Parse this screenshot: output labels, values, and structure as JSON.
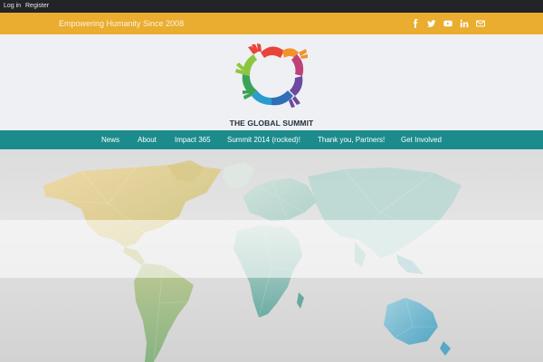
{
  "topbar": {
    "login": "Log in",
    "register": "Register"
  },
  "tagbar": {
    "tagline": "Empowering Humanity Since 2008",
    "social": [
      "facebook-icon",
      "twitter-icon",
      "youtube-icon",
      "linkedin-icon",
      "email-icon"
    ]
  },
  "header": {
    "brand": "THE GLOBAL SUMMIT"
  },
  "nav": {
    "items": [
      {
        "label": "News"
      },
      {
        "label": "About"
      },
      {
        "label": "Impact 365"
      },
      {
        "label": "Summit 2014 (rocked)!"
      },
      {
        "label": "Thank you, Partners!"
      },
      {
        "label": "Get Involved"
      }
    ]
  },
  "colors": {
    "topbar": "#222427",
    "tagbar": "#eaad30",
    "nav": "#1c8b8c",
    "brand_text": "#24303d"
  }
}
